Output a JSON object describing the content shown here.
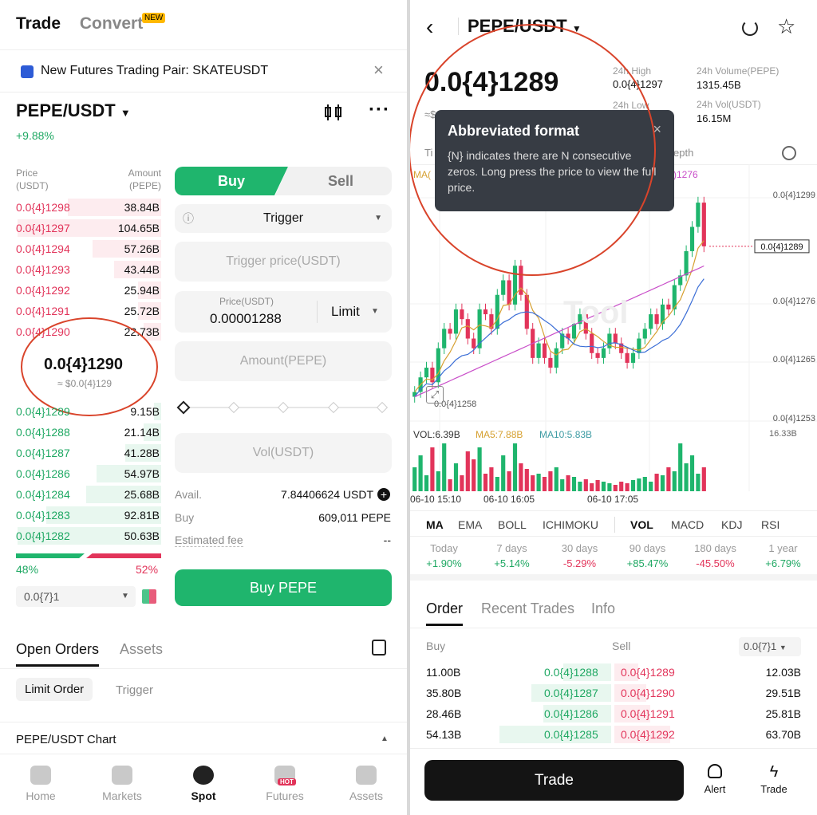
{
  "left": {
    "tab_trade": "Trade",
    "tab_convert": "Convert",
    "badge_new": "NEW",
    "banner_text": "New Futures Trading Pair: SKATEUSDT",
    "pair": "PEPE/USDT",
    "change": "+9.88%",
    "ob_header_price": "Price\n(USDT)",
    "ob_header_amount": "Amount\n(PEPE)",
    "asks": [
      {
        "price": "0.0{4}1298",
        "amount": "38.84B",
        "depth": 0.65
      },
      {
        "price": "0.0{4}1297",
        "amount": "104.65B",
        "depth": 1.0
      },
      {
        "price": "0.0{4}1294",
        "amount": "57.26B",
        "depth": 0.48
      },
      {
        "price": "0.0{4}1293",
        "amount": "43.44B",
        "depth": 0.33
      },
      {
        "price": "0.0{4}1292",
        "amount": "25.94B",
        "depth": 0.16
      },
      {
        "price": "0.0{4}1291",
        "amount": "25.72B",
        "depth": 0.16
      },
      {
        "price": "0.0{4}1290",
        "amount": "22.73B",
        "depth": 0.12
      }
    ],
    "mid_price": "0.0{4}1290",
    "mid_usd": "≈ $0.0{4}129",
    "bids": [
      {
        "price": "0.0{4}1289",
        "amount": "9.15B",
        "depth": 0.05
      },
      {
        "price": "0.0{4}1288",
        "amount": "21.14B",
        "depth": 0.12
      },
      {
        "price": "0.0{4}1287",
        "amount": "41.28B",
        "depth": 0.25
      },
      {
        "price": "0.0{4}1286",
        "amount": "54.97B",
        "depth": 0.45
      },
      {
        "price": "0.0{4}1284",
        "amount": "25.68B",
        "depth": 0.52
      },
      {
        "price": "0.0{4}1283",
        "amount": "92.81B",
        "depth": 0.8
      },
      {
        "price": "0.0{4}1282",
        "amount": "50.63B",
        "depth": 1.0
      }
    ],
    "buy_pct": "48%",
    "sell_pct": "52%",
    "precision": "0.0{7}1",
    "buy_tab": "Buy",
    "sell_tab": "Sell",
    "order_type": "Trigger",
    "trigger_price_placeholder": "Trigger price(USDT)",
    "price_label": "Price(USDT)",
    "price_value": "0.00001288",
    "limit_label": "Limit",
    "amount_placeholder": "Amount(PEPE)",
    "vol_placeholder": "Vol(USDT)",
    "avail_label": "Avail.",
    "avail_value": "7.84406624 USDT",
    "buy_label": "Buy",
    "buy_value": "609,011 PEPE",
    "fee_label": "Estimated fee",
    "fee_value": "--",
    "buy_button": "Buy PEPE",
    "open_orders": "Open Orders",
    "assets_tab": "Assets",
    "limit_order": "Limit Order",
    "trigger_tab": "Trigger",
    "chart_link": "PEPE/USDT Chart",
    "nav": [
      "Home",
      "Markets",
      "Spot",
      "Futures",
      "Assets"
    ],
    "hot_badge": "HOT"
  },
  "right": {
    "pair": "PEPE/USDT",
    "price": "0.0{4}1289",
    "high_label": "24h High",
    "high_value": "0.0{4}1297",
    "vol_pepe_label": "24h Volume(PEPE)",
    "vol_pepe_value": "1315.45B",
    "low_label": "24h Low",
    "vol_usdt_label": "24h Vol(USDT)",
    "vol_usdt_value": "16.15M",
    "tooltip_title": "Abbreviated format",
    "tooltip_body": "{N} indicates there are N consecutive zeros. Long press the price to view the full price.",
    "ma_partial": "MA(",
    "ma_value_partial": ")1276",
    "ti_partial": "Ti",
    "depth_partial": "epth",
    "y_labels": [
      "0.0{4}1299",
      "0.0{4}1276",
      "0.0{4}1265",
      "0.0{4}1253"
    ],
    "current_tag": "0.0{4}1289",
    "low_marker": "0.0{4}1258",
    "watermark": "Tool",
    "vol_label": "VOL:6.39B",
    "ma5_label": "MA5:7.88B",
    "ma10_label": "MA10:5.83B",
    "vol_max": "16.33B",
    "x_labels": [
      "06-10 15:10",
      "06-10 16:05",
      "06-10 17:05"
    ],
    "indicators_left": [
      "MA",
      "EMA",
      "BOLL",
      "ICHIMOKU"
    ],
    "indicators_right": [
      "VOL",
      "MACD",
      "KDJ",
      "RSI"
    ],
    "perf": [
      {
        "label": "Today",
        "value": "+1.90%"
      },
      {
        "label": "7 days",
        "value": "+5.14%"
      },
      {
        "label": "30 days",
        "value": "-5.29%"
      },
      {
        "label": "90 days",
        "value": "+85.47%"
      },
      {
        "label": "180 days",
        "value": "-45.50%"
      },
      {
        "label": "1 year",
        "value": "+6.79%"
      }
    ],
    "tabs": [
      "Order",
      "Recent Trades",
      "Info"
    ],
    "buy_col": "Buy",
    "sell_col": "Sell",
    "precision": "0.0{7}1",
    "rows": [
      {
        "buy_amt": "11.00B",
        "buy_price": "0.0{4}1288",
        "sell_price": "0.0{4}1289",
        "sell_amt": "12.03B"
      },
      {
        "buy_amt": "35.80B",
        "buy_price": "0.0{4}1287",
        "sell_price": "0.0{4}1290",
        "sell_amt": "29.51B"
      },
      {
        "buy_amt": "28.46B",
        "buy_price": "0.0{4}1286",
        "sell_price": "0.0{4}1291",
        "sell_amt": "25.81B"
      },
      {
        "buy_amt": "54.13B",
        "buy_price": "0.0{4}1285",
        "sell_price": "0.0{4}1292",
        "sell_amt": "63.70B"
      }
    ],
    "trade_button": "Trade",
    "alert_label": "Alert",
    "trade_label": "Trade"
  },
  "colors": {
    "green": "#1fa863",
    "red": "#e2345a",
    "annotation": "#d9442b"
  }
}
